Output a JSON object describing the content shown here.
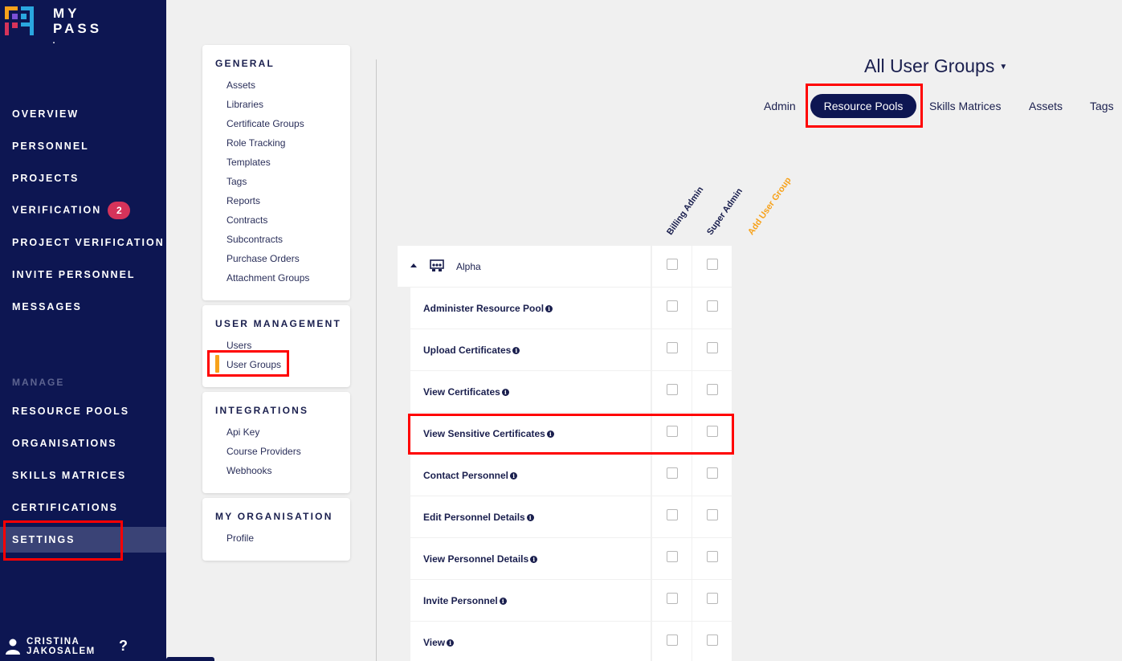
{
  "brand": {
    "line1": "MY",
    "line2": "PASS",
    "mark": "•"
  },
  "nav": {
    "items": [
      "OVERVIEW",
      "PERSONNEL",
      "PROJECTS",
      "VERIFICATION",
      "PROJECT VERIFICATION",
      "INVITE PERSONNEL",
      "MESSAGES"
    ],
    "verification_badge": "2",
    "manage_label": "MANAGE",
    "manage_items": [
      "RESOURCE POOLS",
      "ORGANISATIONS",
      "SKILLS MATRICES",
      "CERTIFICATIONS",
      "SETTINGS"
    ],
    "active": "SETTINGS"
  },
  "user": {
    "first": "CRISTINA",
    "last": "JAKOSALEM",
    "help": "?"
  },
  "settings": {
    "general": {
      "title": "GENERAL",
      "links": [
        "Assets",
        "Libraries",
        "Certificate Groups",
        "Role Tracking",
        "Templates",
        "Tags",
        "Reports",
        "Contracts",
        "Subcontracts",
        "Purchase Orders",
        "Attachment Groups"
      ]
    },
    "user_management": {
      "title": "USER MANAGEMENT",
      "links": [
        "Users",
        "User Groups"
      ]
    },
    "integrations": {
      "title": "INTEGRATIONS",
      "links": [
        "Api Key",
        "Course Providers",
        "Webhooks"
      ]
    },
    "my_organisation": {
      "title": "MY ORGANISATION",
      "links": [
        "Profile"
      ]
    }
  },
  "header": {
    "group_selector": "All User Groups",
    "tabs": [
      "Admin",
      "Resource Pools",
      "Skills Matrices",
      "Assets",
      "Tags"
    ],
    "active_tab": "Resource Pools"
  },
  "columns": {
    "billing_admin": "Billing Admin",
    "super_admin": "Super Admin",
    "add_group": "Add User Group",
    "add_group_color": "#f7a21b"
  },
  "group": {
    "name": "Alpha",
    "expanded": true
  },
  "permissions": [
    "Administer Resource Pool",
    "Upload Certificates",
    "View Certificates",
    "View Sensitive Certificates",
    "Contact Personnel",
    "Edit Personnel Details",
    "View Personnel Details",
    "Invite Personnel",
    "View"
  ],
  "info_glyph": "i"
}
